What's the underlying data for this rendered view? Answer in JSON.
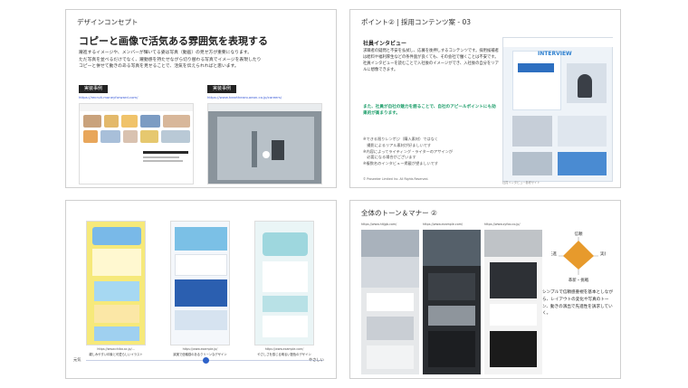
{
  "slides": {
    "s1": {
      "title": "デザインコンセプト",
      "headline": "コピーと画像で活気ある雰囲気を表現する",
      "body": [
        "躍進するイメージや、メンバーが輝いてる姿は写真（動画）の見せ方が重要になります。",
        "ただ写真を並べるだけでなく、躍動感を持たせながら切り替わる写真でイメージを表現したり",
        "コピーと併せて動きのある写真を見せることで、活気を伝えられればと思います。"
      ],
      "examples": [
        {
          "label": "実装事例",
          "url": "https://recruit.moneyforward.com/"
        },
        {
          "label": "実装事例",
          "url": "https://www.hearthearo.aeon.co.jp/careers/"
        }
      ]
    },
    "s2": {
      "title": "ポイント② | 採用コンテンツ案 - 03",
      "heading": "社員インタビュー",
      "text": "求職者の疑問と不安を払拭し、応募を後押しするコンテンツです。採用候補者は給料や福利厚生などの条件面が良くても、その会社で働くことは不安です。社員インタビューを読むことで入社後のイメージができ、入社後の自分をリアルに想像できます。",
      "accent": "また、社員が自社の魅力を語ることで、自社のアピールポイントにも効果的が高まります。",
      "notes": [
        "※できる限りレンポジ（購入素材）ではなく",
        "　撮影によるリアル素材が好ましいです",
        "※内容によってライティング・ライターのアサインが",
        "　必要になる場合がございます",
        "※複数名のインタビュー掲載が望ましいです"
      ],
      "copyright": "© Proseeker Limited Inc. All Rights Reserved.",
      "mock_heading": "INTERVIEW",
      "caption": "社員インタビュー参考サイト"
    },
    "s3": {
      "sites": [
        {
          "url": "https://www.chiba.ac.jp/...",
          "caption": "親しみやすい印象と可愛らしいイラスト"
        },
        {
          "url": "https://www.example.jp/",
          "caption": "誠実で信頼感のあるクリーンなデザイン"
        },
        {
          "url": "https://www.example.com/",
          "caption": "やさしさを感じる明るい配色のデザイン"
        }
      ],
      "scale_left": "元気",
      "scale_right": "やさしい"
    },
    "s4": {
      "title": "全体のトーン＆マナー ②",
      "urls": [
        "https://www.hitjgb.com/",
        "https://www.example.com/",
        "https://www.syfoo.co.jp/"
      ],
      "radar_top": "信頼",
      "radar_left": "先進",
      "radar_right": "実感",
      "radar_bottom": "革新・挑戦",
      "description": "シンプルで信頼感重視を基本としながら、レイアウトの変化や写真のトーン、動きの演出で先進性を訴求していく。"
    }
  }
}
